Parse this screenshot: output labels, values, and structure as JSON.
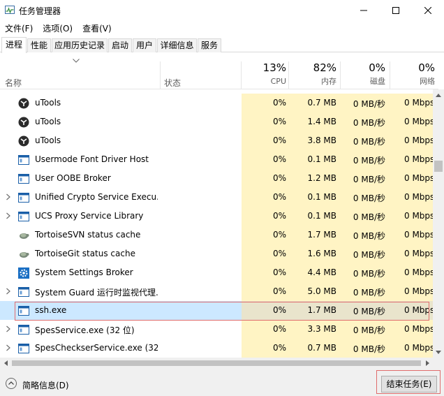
{
  "window": {
    "title": "任务管理器"
  },
  "menu": [
    "文件(F)",
    "选项(O)",
    "查看(V)"
  ],
  "tabs": [
    "进程",
    "性能",
    "应用历史记录",
    "启动",
    "用户",
    "详细信息",
    "服务"
  ],
  "columns": {
    "name": "名称",
    "status": "状态",
    "cpu": {
      "pct": "13%",
      "label": "CPU"
    },
    "mem": {
      "pct": "82%",
      "label": "内存"
    },
    "disk": {
      "pct": "0%",
      "label": "磁盘"
    },
    "net": {
      "pct": "0%",
      "label": "网络"
    }
  },
  "rows": [
    {
      "name": "uTools",
      "icon": "utools-icon",
      "expandable": false,
      "cpu": "0%",
      "mem": "0.7 MB",
      "disk": "0 MB/秒",
      "net": "0 Mbps"
    },
    {
      "name": "uTools",
      "icon": "utools-icon",
      "expandable": false,
      "cpu": "0%",
      "mem": "1.4 MB",
      "disk": "0 MB/秒",
      "net": "0 Mbps"
    },
    {
      "name": "uTools",
      "icon": "utools-icon",
      "expandable": false,
      "cpu": "0%",
      "mem": "3.8 MB",
      "disk": "0 MB/秒",
      "net": "0 Mbps"
    },
    {
      "name": "Usermode Font Driver Host",
      "icon": "process-window-icon",
      "expandable": false,
      "cpu": "0%",
      "mem": "0.1 MB",
      "disk": "0 MB/秒",
      "net": "0 Mbps"
    },
    {
      "name": "User OOBE Broker",
      "icon": "process-window-icon",
      "expandable": false,
      "cpu": "0%",
      "mem": "1.2 MB",
      "disk": "0 MB/秒",
      "net": "0 Mbps"
    },
    {
      "name": "Unified Crypto Service Execu...",
      "icon": "process-window-icon",
      "expandable": true,
      "cpu": "0%",
      "mem": "0.1 MB",
      "disk": "0 MB/秒",
      "net": "0 Mbps"
    },
    {
      "name": "UCS Proxy Service Library",
      "icon": "process-window-icon",
      "expandable": true,
      "cpu": "0%",
      "mem": "0.1 MB",
      "disk": "0 MB/秒",
      "net": "0 Mbps"
    },
    {
      "name": "TortoiseSVN status cache",
      "icon": "tortoise-icon",
      "expandable": false,
      "cpu": "0%",
      "mem": "1.7 MB",
      "disk": "0 MB/秒",
      "net": "0 Mbps"
    },
    {
      "name": "TortoiseGit status cache",
      "icon": "tortoise-icon",
      "expandable": false,
      "cpu": "0%",
      "mem": "1.6 MB",
      "disk": "0 MB/秒",
      "net": "0 Mbps"
    },
    {
      "name": "System Settings Broker",
      "icon": "settings-gear-icon",
      "expandable": false,
      "cpu": "0%",
      "mem": "4.4 MB",
      "disk": "0 MB/秒",
      "net": "0 Mbps"
    },
    {
      "name": "System Guard 运行时监视代理...",
      "icon": "process-window-icon",
      "expandable": true,
      "cpu": "0%",
      "mem": "5.0 MB",
      "disk": "0 MB/秒",
      "net": "0 Mbps"
    },
    {
      "name": "ssh.exe",
      "icon": "process-window-icon",
      "expandable": false,
      "selected": true,
      "cpu": "0%",
      "mem": "1.7 MB",
      "disk": "0 MB/秒",
      "net": "0 Mbps"
    },
    {
      "name": "SpesService.exe (32 位)",
      "icon": "process-window-icon",
      "expandable": true,
      "cpu": "0%",
      "mem": "3.3 MB",
      "disk": "0 MB/秒",
      "net": "0 Mbps"
    },
    {
      "name": "SpesCheckserService.exe (32...",
      "icon": "process-window-icon",
      "expandable": true,
      "cpu": "0%",
      "mem": "0.7 MB",
      "disk": "0 MB/秒",
      "net": "0 Mbps"
    }
  ],
  "footer": {
    "collapse_label": "简略信息(D)",
    "end_task_label": "结束任务(E)"
  },
  "colors": {
    "metric_bg": "#fff4c4",
    "selected_bg": "#cce8ff",
    "highlight_border": "#e06c6c"
  }
}
